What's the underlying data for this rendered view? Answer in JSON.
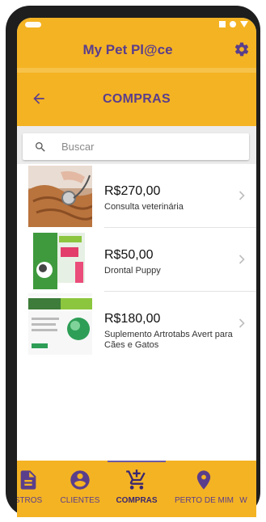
{
  "app": {
    "title": "My Pet Pl@ce"
  },
  "page": {
    "title": "COMPRAS"
  },
  "search": {
    "placeholder": "Buscar",
    "value": ""
  },
  "items": [
    {
      "price": "R$270,00",
      "description": "Consulta veterinária",
      "image": "veterinarian-cat-photo"
    },
    {
      "price": "R$50,00",
      "description": "Drontal Puppy",
      "image": "drontal-puppy-box"
    },
    {
      "price": "R$180,00",
      "description": "Suplemento Artrotabs Avert para Cães e Gatos",
      "image": "artrotabs-vet-box"
    }
  ],
  "nav": {
    "items": [
      {
        "label": "STROS",
        "icon": "document-icon"
      },
      {
        "label": "CLIENTES",
        "icon": "person-circle-icon"
      },
      {
        "label": "COMPRAS",
        "icon": "cart-icon",
        "active": true
      },
      {
        "label": "PERTO DE MIM",
        "icon": "location-pin-icon"
      },
      {
        "label": "W",
        "icon": ""
      }
    ]
  },
  "colors": {
    "primary": "#F4B323",
    "accent": "#5A3E8C",
    "indicator": "#6D5AA5"
  }
}
